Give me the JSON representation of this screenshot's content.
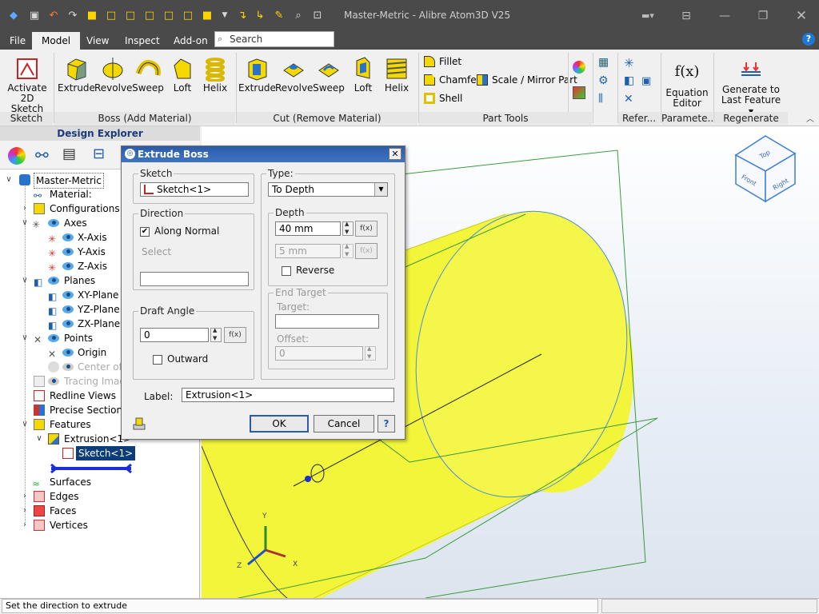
{
  "app": {
    "title": "Master-Metric - Alibre Atom3D V25"
  },
  "menu": {
    "items": [
      "File",
      "Model",
      "View",
      "Inspect",
      "Add-on"
    ],
    "active": "Model",
    "search_placeholder": "Search",
    "help_label": "?"
  },
  "ribbon": {
    "sketch_group": {
      "label": "Sketch",
      "activate_label": "Activate 2D Sketch"
    },
    "boss_group": {
      "label": "Boss (Add Material)",
      "buttons": [
        "Extrude",
        "Revolve",
        "Sweep",
        "Loft",
        "Helix"
      ]
    },
    "cut_group": {
      "label": "Cut (Remove Material)",
      "buttons": [
        "Extrude",
        "Revolve",
        "Sweep",
        "Loft",
        "Helix"
      ]
    },
    "part_tools": {
      "label": "Part Tools",
      "fillet": "Fillet",
      "chamfer": "Chamfer",
      "shell": "Shell",
      "scale_mirror": "Scale / Mirror Part"
    },
    "refer_group": {
      "label": "Refer..."
    },
    "param_group": {
      "label": "Paramete...",
      "equation_label": "Equation Editor",
      "fx": "f(x)"
    },
    "regen_group": {
      "label": "Regenerate",
      "button_label": "Generate to Last Feature"
    }
  },
  "explorer": {
    "title": "Design Explorer",
    "tree": {
      "root": "Master-Metric",
      "material": "Material:",
      "configurations": "Configurations",
      "axes": "Axes",
      "x_axis": "X-Axis",
      "y_axis": "Y-Axis",
      "z_axis": "Z-Axis",
      "planes": "Planes",
      "xy_plane": "XY-Plane",
      "yz_plane": "YZ-Plane",
      "zx_plane": "ZX-Plane",
      "points": "Points",
      "origin": "Origin",
      "center_of_mass": "Center of M",
      "tracing_images": "Tracing Images",
      "redline_views": "Redline Views",
      "precise_section": "Precise Section Vie",
      "features": "Features",
      "extrusion": "Extrusion<1>",
      "sketch": "Sketch<1>",
      "surfaces": "Surfaces",
      "edges": "Edges",
      "faces": "Faces",
      "vertices": "Vertices"
    }
  },
  "dialog": {
    "title": "Extrude Boss",
    "close_label": "✕",
    "sketch_group": "Sketch",
    "sketch_value": "Sketch<1>",
    "direction_group": "Direction",
    "along_normal": "Along Normal",
    "along_normal_checked": true,
    "select_label": "Select",
    "draft_group": "Draft Angle",
    "draft_value": "0",
    "outward": "Outward",
    "outward_checked": false,
    "type_group": "Type:",
    "type_value": "To Depth",
    "depth_group": "Depth",
    "depth_value": "40 mm",
    "depth2_value": "5 mm",
    "reverse": "Reverse",
    "reverse_checked": false,
    "end_target_group": "End Target",
    "target_label": "Target:",
    "offset_label": "Offset:",
    "offset_value": "0",
    "fx": "f(x)",
    "label_label": "Label:",
    "label_value": "Extrusion<1>",
    "ok": "OK",
    "cancel": "Cancel",
    "help": "?"
  },
  "viewcube": {
    "top": "Top",
    "front": "Front",
    "right": "Right"
  },
  "triad": {
    "x": "X",
    "y": "Y",
    "z": "Z"
  },
  "status": {
    "text": "Set the direction to extrude"
  },
  "colors": {
    "part": "#f2f53a",
    "accent": "#2b5ca8",
    "titlebar": "#4a4a4a"
  }
}
